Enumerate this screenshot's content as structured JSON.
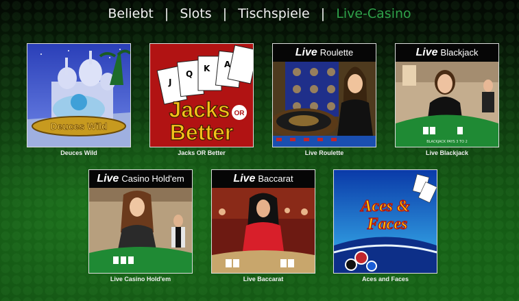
{
  "nav": {
    "items": [
      "Beliebt",
      "Slots",
      "Tischspiele",
      "Live-Casino"
    ],
    "separator": "|",
    "active": "Live-Casino",
    "active_color": "#2fa24a"
  },
  "games": [
    {
      "caption": "Deuces Wild",
      "logo_text": "Deuces Wild"
    },
    {
      "caption": "Jacks OR Better",
      "logo_line1": "Jacks",
      "logo_or": "OR",
      "logo_line2": "Better"
    },
    {
      "caption": "Live Roulette",
      "live": "Live",
      "title": "Roulette"
    },
    {
      "caption": "Live Blackjack",
      "live": "Live",
      "title": "Blackjack"
    },
    {
      "caption": "Live Casino Hold'em",
      "live": "Live",
      "title": "Casino Hold'em"
    },
    {
      "caption": "Live Baccarat",
      "live": "Live",
      "title": "Baccarat"
    },
    {
      "caption": "Aces and Faces",
      "logo_line1": "Aces &",
      "logo_line2": "Faces"
    }
  ]
}
